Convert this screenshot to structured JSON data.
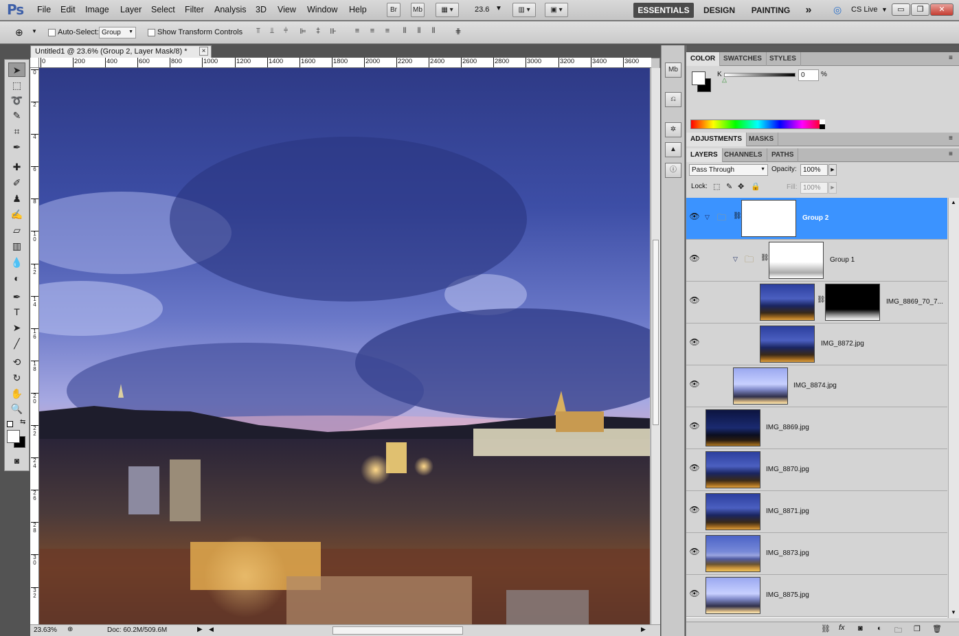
{
  "app": {
    "logo": "Ps"
  },
  "menu": [
    "File",
    "Edit",
    "Image",
    "Layer",
    "Select",
    "Filter",
    "Analysis",
    "3D",
    "View",
    "Window",
    "Help"
  ],
  "appbar": {
    "br_label": "Br",
    "mb_label": "Mb",
    "zoom": "23.6"
  },
  "workspaces": {
    "essentials": "ESSENTIALS",
    "design": "DESIGN",
    "painting": "PAINTING",
    "more": "»",
    "cslive": "CS Live"
  },
  "options": {
    "auto_select_label": "Auto-Select:",
    "auto_select_value": "Group",
    "show_transform_label": "Show Transform Controls"
  },
  "document": {
    "tab_title": "Untitled1 @ 23.6% (Group 2, Layer Mask/8) *",
    "close": "×",
    "hruler": [
      "0",
      "200",
      "400",
      "600",
      "800",
      "1000",
      "1200",
      "1400",
      "1600",
      "1800",
      "2000",
      "2200",
      "2400",
      "2600",
      "2800",
      "3000",
      "3200",
      "3400",
      "3600"
    ],
    "vruler": [
      "0",
      "2",
      "4",
      "6",
      "8",
      "1 0",
      "1 2",
      "1 4",
      "1 6",
      "1 8",
      "2 0",
      "2 2",
      "2 4",
      "2 6",
      "2 8",
      "3 0",
      "3 2"
    ],
    "zoom_status": "23.63%",
    "doc_status": "Doc: 60.2M/509.6M"
  },
  "panels": {
    "color_tabs": [
      "COLOR",
      "SWATCHES",
      "STYLES"
    ],
    "color_channel": "K",
    "color_value": "0",
    "color_unit": "%",
    "adjust_tabs": [
      "ADJUSTMENTS",
      "MASKS"
    ],
    "layer_tabs": [
      "LAYERS",
      "CHANNELS",
      "PATHS"
    ],
    "blend_mode": "Pass Through",
    "opacity_label": "Opacity:",
    "opacity_value": "100%",
    "lock_label": "Lock:",
    "fill_label": "Fill:",
    "fill_value": "100%"
  },
  "layers": [
    {
      "name": "Group 2",
      "type": "group",
      "selected": true
    },
    {
      "name": "Group 1",
      "type": "group"
    },
    {
      "name": "IMG_8869_70_7...",
      "type": "masked"
    },
    {
      "name": "IMG_8872.jpg",
      "type": "image"
    },
    {
      "name": "IMG_8874.jpg",
      "type": "image"
    },
    {
      "name": "IMG_8869.jpg",
      "type": "image"
    },
    {
      "name": "IMG_8870.jpg",
      "type": "image"
    },
    {
      "name": "IMG_8871.jpg",
      "type": "image"
    },
    {
      "name": "IMG_8873.jpg",
      "type": "image"
    },
    {
      "name": "IMG_8875.jpg",
      "type": "image"
    }
  ],
  "colors": {
    "selection": "#3b93ff",
    "accent_dark": "#4a4a4a"
  }
}
